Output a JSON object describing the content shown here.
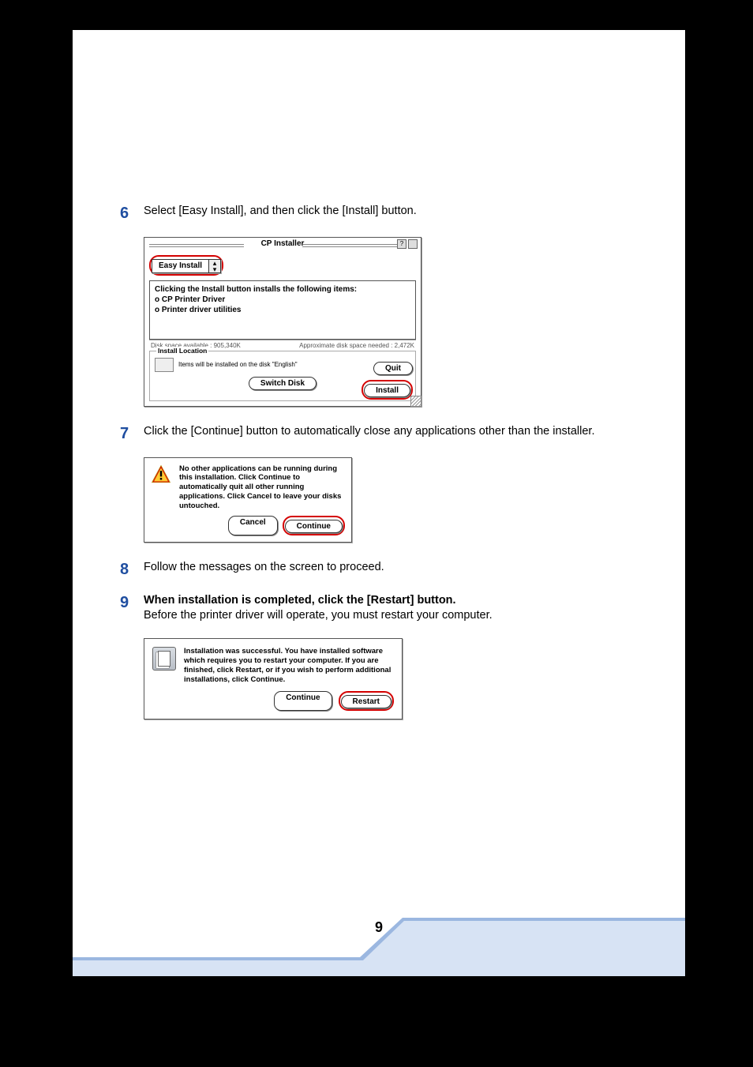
{
  "page_number": "9",
  "steps": {
    "s6": {
      "num": "6",
      "title": "Select [Easy Install], and then click the [Install] button."
    },
    "s7": {
      "num": "7",
      "title": "Click the [Continue] button to automatically close any applications other than the installer."
    },
    "s8": {
      "num": "8",
      "title": "Follow the messages on the screen to proceed."
    },
    "s9": {
      "num": "9",
      "title": "When installation is completed, click the [Restart] button.",
      "sub": "Before the printer driver will operate, you must restart your computer."
    }
  },
  "installer": {
    "window_title": "CP Installer",
    "dropdown": "Easy Install",
    "desc_heading": "Clicking the Install button installs the following items:",
    "item1": "o CP Printer Driver",
    "item2": "o Printer driver utilities",
    "disk_space_avail": "Disk space available : 905,340K",
    "disk_space_needed": "Approximate disk space needed : 2,472K",
    "install_location_label": "Install Location",
    "install_location_text": "Items will be installed on the disk \"English\"",
    "switch_disk": "Switch Disk",
    "quit": "Quit",
    "install": "Install"
  },
  "dialog_continue": {
    "text": "No other applications can be running during this installation. Click Continue to automatically quit all other running applications. Click Cancel to leave your disks untouched.",
    "cancel": "Cancel",
    "continue": "Continue"
  },
  "dialog_restart": {
    "text": "Installation was successful. You have installed software which requires you to restart your computer. If you are finished, click Restart, or if you wish to perform additional installations, click Continue.",
    "continue": "Continue",
    "restart": "Restart"
  }
}
